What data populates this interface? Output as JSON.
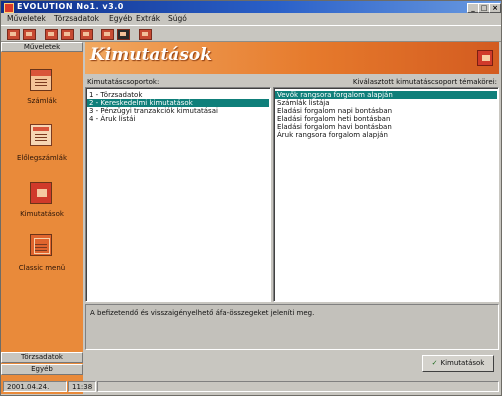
{
  "window": {
    "title": "EVOLUTION  No1. v3.0",
    "min_glyph": "_",
    "max_glyph": "□",
    "close_glyph": "×"
  },
  "menu": [
    "Műveletek",
    "Törzsadatok",
    "Egyéb",
    "Extrák",
    "Súgó"
  ],
  "sidebar": {
    "header": "Műveletek",
    "items": [
      {
        "label": "Számlák",
        "icon": "invoice-icon"
      },
      {
        "label": "Előlegszámlák",
        "icon": "advance-invoice-icon"
      },
      {
        "label": "Kimutatások",
        "icon": "report-icon"
      },
      {
        "label": "Classic menü",
        "icon": "classic-menu-icon"
      }
    ],
    "bottom": [
      "Törzsadatok",
      "Egyéb"
    ]
  },
  "banner": {
    "title": "Kimutatások",
    "icon": "report-icon"
  },
  "groups": {
    "label": "Kimutatáscsoportok:",
    "items": [
      "1 - Törzsadatok",
      "2 - Kereskedelmi kimutatások",
      "3 - Pénzügyi tranzakciók kimutatásai",
      "4 - Áruk listái"
    ],
    "selected_index": 1
  },
  "reports": {
    "label": "Kiválasztott kimutatáscsoport témakörei:",
    "items": [
      "Vevők rangsora forgalom alapján",
      "Számlák listája",
      "Eladási forgalom napi bontásban",
      "Eladási forgalom heti bontásban",
      "Eladási forgalom havi bontásban",
      "Áruk rangsora forgalom alapján"
    ],
    "selected_index": 0
  },
  "description": "A befizetendő és visszaigényelhető áfa-összegeket jeleníti meg.",
  "action_button": "Kimutatások",
  "status": {
    "date": "2001.04.24.",
    "time": "11:38"
  },
  "colors": {
    "accent_orange": "#e98a3a",
    "selection": "#0f7f7a",
    "title_blue": "#0f2f8a"
  }
}
